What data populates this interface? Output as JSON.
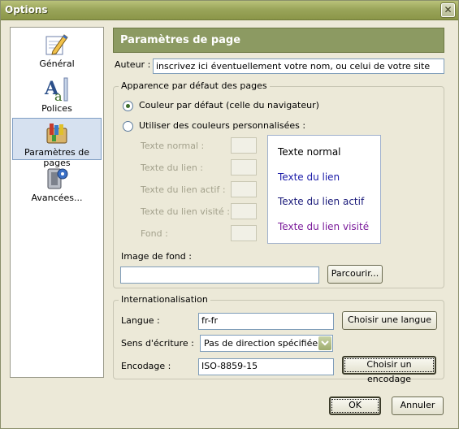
{
  "window": {
    "title": "Options",
    "close_glyph": "✕"
  },
  "sidebar": {
    "items": [
      {
        "label": "Général",
        "icon": "pencil-paper-icon"
      },
      {
        "label": "Polices",
        "icon": "font-icon"
      },
      {
        "label": "Paramètres de pages",
        "icon": "paint-tubes-icon",
        "selected": true
      },
      {
        "label": "Avancées...",
        "icon": "advanced-gear-icon"
      }
    ]
  },
  "header": {
    "title": "Paramètres de page"
  },
  "author": {
    "label": "Auteur :",
    "value": "inscrivez ici éventuellement votre nom, ou celui de votre site"
  },
  "appearance": {
    "legend": "Apparence par défaut des pages",
    "radio_default": "Couleur par défaut (celle du navigateur)",
    "radio_custom": "Utiliser des couleurs personnalisées :",
    "color_labels": [
      "Texte normal :",
      "Texte du lien :",
      "Texte du lien actif :",
      "Texte du lien visité :",
      "Fond :"
    ],
    "preview": {
      "normal": "Texte normal",
      "link": "Texte du lien",
      "active": "Texte du lien actif",
      "visited": "Texte du lien visité"
    },
    "preview_colors": {
      "normal": "#000000",
      "link": "#1a1aa8",
      "active": "#1a1a7a",
      "visited": "#7a1a9a"
    },
    "bg_image_label": "Image de fond :",
    "bg_image_value": "",
    "browse_button": "Parcourir..."
  },
  "i18n": {
    "legend": "Internationalisation",
    "language_label": "Langue :",
    "language_value": "fr-fr",
    "language_button": "Choisir une langue",
    "direction_label": "Sens d'écriture :",
    "direction_value": "Pas de direction spécifiée",
    "encoding_label": "Encodage :",
    "encoding_value": "ISO-8859-15",
    "encoding_button": "Choisir un encodage"
  },
  "footer": {
    "ok": "OK",
    "cancel": "Annuler"
  }
}
